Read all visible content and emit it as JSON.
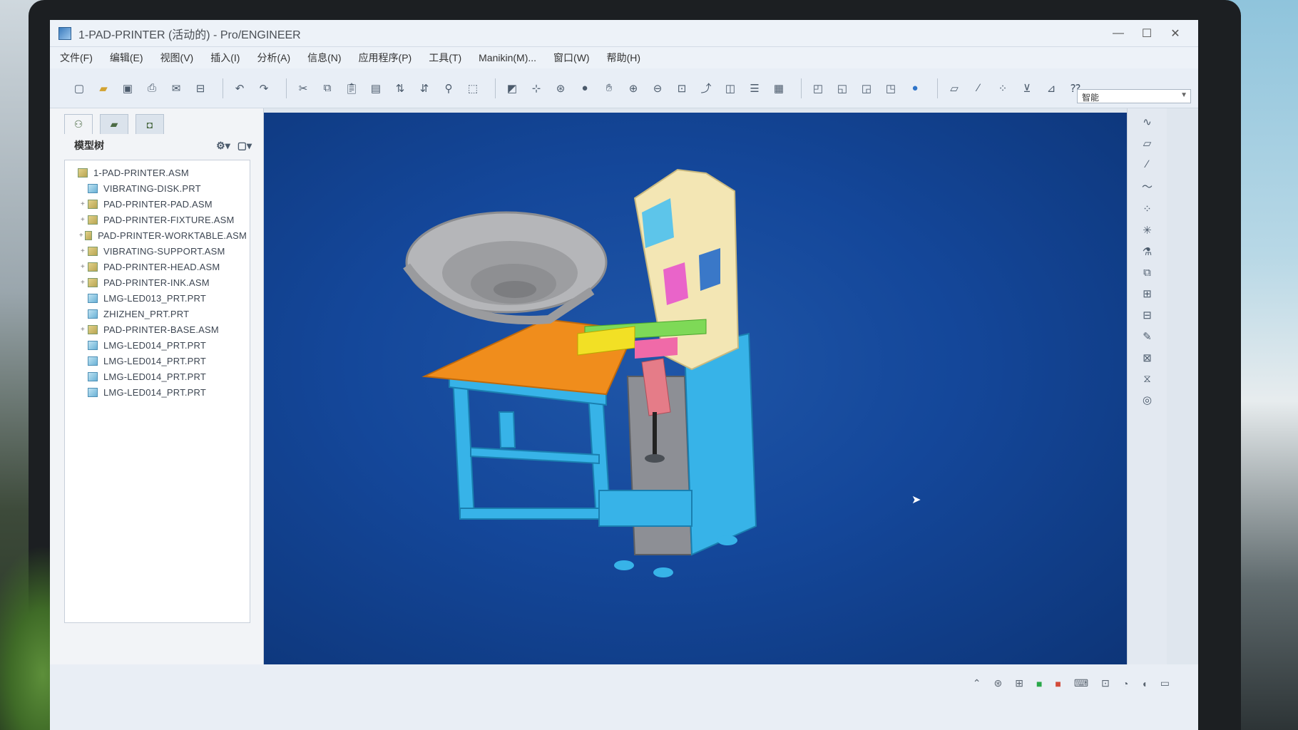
{
  "window": {
    "title": "1-PAD-PRINTER (活动的) - Pro/ENGINEER",
    "controls": [
      "—",
      "☐",
      "✕"
    ]
  },
  "menu": [
    "文件(F)",
    "编辑(E)",
    "视图(V)",
    "插入(I)",
    "分析(A)",
    "信息(N)",
    "应用程序(P)",
    "工具(T)",
    "Manikin(M)...",
    "窗口(W)",
    "帮助(H)"
  ],
  "toolbar": {
    "filter_value": "智能"
  },
  "nav_panel": {
    "title": "模型树",
    "tree": [
      {
        "label": "1-PAD-PRINTER.ASM",
        "type": "asm",
        "expandable": false,
        "root": true
      },
      {
        "label": "VIBRATING-DISK.PRT",
        "type": "prt",
        "expandable": false
      },
      {
        "label": "PAD-PRINTER-PAD.ASM",
        "type": "asm",
        "expandable": true
      },
      {
        "label": "PAD-PRINTER-FIXTURE.ASM",
        "type": "asm",
        "expandable": true
      },
      {
        "label": "PAD-PRINTER-WORKTABLE.ASM",
        "type": "asm",
        "expandable": true
      },
      {
        "label": "VIBRATING-SUPPORT.ASM",
        "type": "asm",
        "expandable": true
      },
      {
        "label": "PAD-PRINTER-HEAD.ASM",
        "type": "asm",
        "expandable": true
      },
      {
        "label": "PAD-PRINTER-INK.ASM",
        "type": "asm",
        "expandable": true
      },
      {
        "label": "LMG-LED013_PRT.PRT",
        "type": "prt",
        "expandable": false
      },
      {
        "label": "ZHIZHEN_PRT.PRT",
        "type": "prt",
        "expandable": false
      },
      {
        "label": "PAD-PRINTER-BASE.ASM",
        "type": "asm",
        "expandable": true
      },
      {
        "label": "LMG-LED014_PRT.PRT",
        "type": "prt",
        "expandable": false
      },
      {
        "label": "LMG-LED014_PRT.PRT",
        "type": "prt",
        "expandable": false
      },
      {
        "label": "LMG-LED014_PRT.PRT",
        "type": "prt",
        "expandable": false
      },
      {
        "label": "LMG-LED014_PRT.PRT",
        "type": "prt",
        "expandable": false
      }
    ]
  },
  "colors": {
    "viewport_bg": "#14479a",
    "frame_blue": "#37b3e8",
    "table_top": "#f08d1c",
    "bowl_gray": "#a9aaad",
    "machine_cream": "#f3e6b4"
  }
}
